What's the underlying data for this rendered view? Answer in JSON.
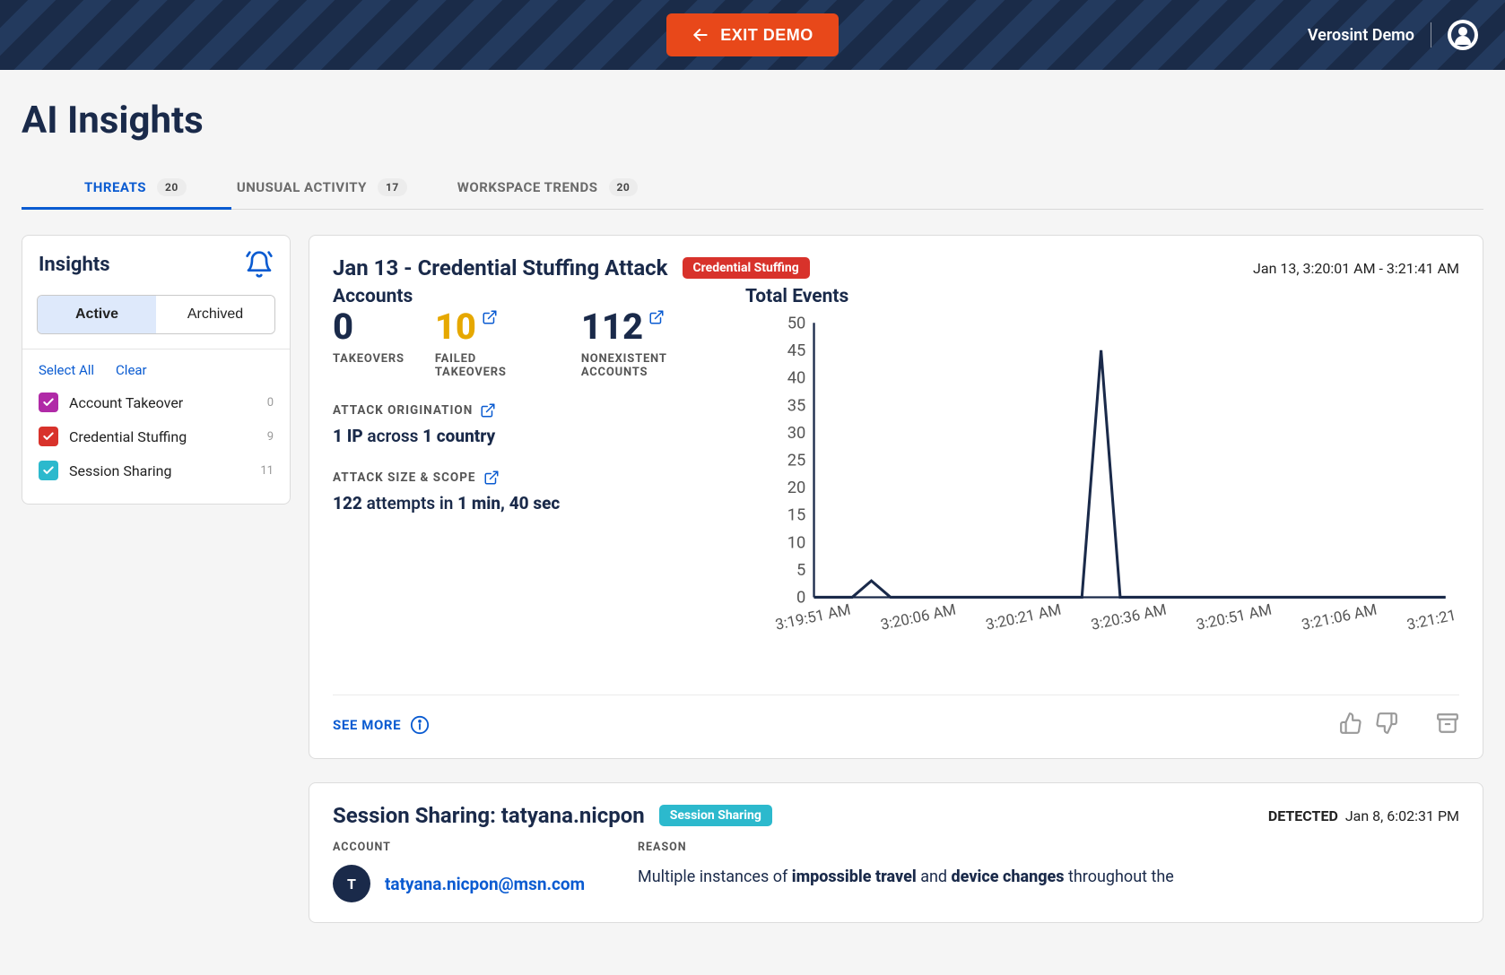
{
  "header": {
    "exit_label": "EXIT DEMO",
    "org_label": "Verosint Demo"
  },
  "page": {
    "title": "AI Insights"
  },
  "tabs": [
    {
      "label": "THREATS",
      "count": "20",
      "active": true
    },
    {
      "label": "UNUSUAL ACTIVITY",
      "count": "17",
      "active": false
    },
    {
      "label": "WORKSPACE TRENDS",
      "count": "20",
      "active": false
    }
  ],
  "sidebar": {
    "title": "Insights",
    "segments": {
      "active": "Active",
      "archived": "Archived"
    },
    "select_all": "Select All",
    "clear": "Clear",
    "filters": [
      {
        "label": "Account Takeover",
        "count": "0",
        "color": "#b02aa7"
      },
      {
        "label": "Credential Stuffing",
        "count": "9",
        "color": "#d8322b"
      },
      {
        "label": "Session Sharing",
        "count": "11",
        "color": "#2cb9cd"
      }
    ]
  },
  "card1": {
    "title": "Jan 13 - Credential Stuffing Attack",
    "badge": "Credential Stuffing",
    "time_range": "Jan 13, 3:20:01 AM - 3:21:41 AM",
    "accounts_h": "Accounts",
    "stats": {
      "takeovers": {
        "value": "0",
        "label": "TAKEOVERS"
      },
      "failed": {
        "value": "10",
        "label": "FAILED TAKEOVERS"
      },
      "nonexist": {
        "value": "112",
        "label": "NONEXISTENT ACCOUNTS"
      }
    },
    "origination_h": "ATTACK ORIGINATION",
    "origination_t_prefix": "1 IP",
    "origination_t_mid": " across ",
    "origination_t_suffix": "1 country",
    "size_h": "ATTACK SIZE & SCOPE",
    "size_t_1": "122",
    "size_t_2": " attempts in ",
    "size_t_3": "1 min, 40 sec",
    "events_h": "Total Events",
    "see_more": "SEE MORE"
  },
  "card2": {
    "title": "Session Sharing: tatyana.nicpon",
    "badge": "Session Sharing",
    "detected_label": "DETECTED",
    "detected_time": "Jan 8, 6:02:31 PM",
    "account_h": "ACCOUNT",
    "account_initial": "T",
    "account_email": "tatyana.nicpon@msn.com",
    "reason_h": "REASON",
    "reason_1": "Multiple instances of ",
    "reason_b1": "impossible travel",
    "reason_2": " and ",
    "reason_b2": "device changes",
    "reason_3": " throughout the"
  },
  "chart_data": {
    "type": "line",
    "title": "Total Events",
    "xlabel": "",
    "ylabel": "",
    "ylim": [
      0,
      50
    ],
    "y_ticks": [
      0,
      5,
      10,
      15,
      20,
      25,
      30,
      35,
      40,
      45,
      50
    ],
    "x_ticks": [
      "3:19:51 AM",
      "3:20:06 AM",
      "3:20:21 AM",
      "3:20:36 AM",
      "3:20:51 AM",
      "3:21:06 AM",
      "3:21:21 AM"
    ],
    "x": [
      "3:19:51",
      "3:19:54",
      "3:19:57",
      "3:20:00",
      "3:20:03",
      "3:20:06",
      "3:20:09",
      "3:20:12",
      "3:20:15",
      "3:20:18",
      "3:20:21",
      "3:20:24",
      "3:20:27",
      "3:20:30",
      "3:20:33",
      "3:20:36",
      "3:20:39",
      "3:20:42",
      "3:20:45",
      "3:20:48",
      "3:20:51",
      "3:20:54",
      "3:20:57",
      "3:21:00",
      "3:21:03",
      "3:21:06",
      "3:21:09",
      "3:21:12",
      "3:21:15",
      "3:21:18",
      "3:21:21",
      "3:21:24",
      "3:21:27",
      "3:21:30"
    ],
    "values": [
      0,
      0,
      0,
      3,
      0,
      0,
      0,
      0,
      0,
      0,
      0,
      0,
      0,
      0,
      0,
      45,
      0,
      0,
      0,
      0,
      0,
      0,
      0,
      0,
      0,
      0,
      0,
      0,
      0,
      0,
      0,
      0,
      0,
      0
    ]
  }
}
